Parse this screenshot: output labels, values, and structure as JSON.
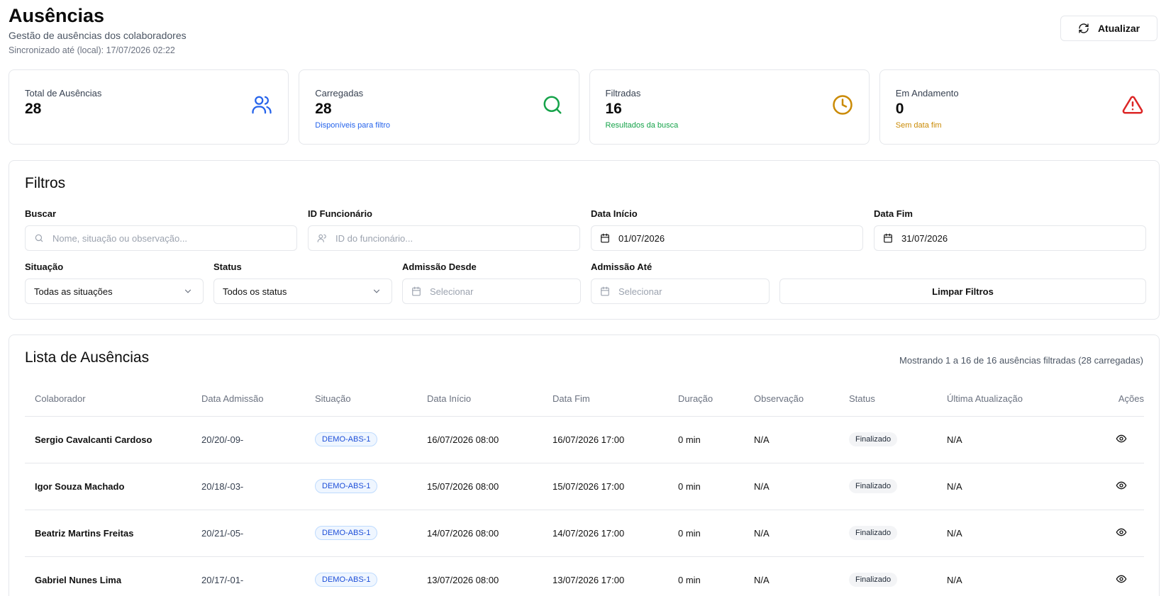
{
  "header": {
    "title": "Ausências",
    "subtitle": "Gestão de ausências dos colaboradores",
    "sync": "Sincronizado até (local): 17/07/2026 02:22",
    "refresh_label": "Atualizar"
  },
  "stats": [
    {
      "label": "Total de Ausências",
      "value": "28",
      "sub": "",
      "icon": "users-icon",
      "color": "#2563eb"
    },
    {
      "label": "Carregadas",
      "value": "28",
      "sub": "Disponíveis para filtro",
      "icon": "search-icon",
      "color": "#16a34a"
    },
    {
      "label": "Filtradas",
      "value": "16",
      "sub": "Resultados da busca",
      "icon": "clock-icon",
      "color": "#ca8a04"
    },
    {
      "label": "Em Andamento",
      "value": "0",
      "sub": "Sem data fim",
      "icon": "alert-triangle-icon",
      "color": "#dc2626"
    }
  ],
  "filters": {
    "title": "Filtros",
    "search": {
      "label": "Buscar",
      "placeholder": "Nome, situação ou observação..."
    },
    "employee": {
      "label": "ID Funcionário",
      "placeholder": "ID do funcionário..."
    },
    "start": {
      "label": "Data Início",
      "value": "01/07/2026"
    },
    "end": {
      "label": "Data Fim",
      "value": "31/07/2026"
    },
    "situation": {
      "label": "Situação",
      "value": "Todas as situações"
    },
    "status": {
      "label": "Status",
      "value": "Todos os status"
    },
    "adm_from": {
      "label": "Admissão Desde",
      "placeholder": "Selecionar"
    },
    "adm_to": {
      "label": "Admissão Até",
      "placeholder": "Selecionar"
    },
    "clear_label": "Limpar Filtros"
  },
  "list": {
    "title": "Lista de Ausências",
    "info": "Mostrando 1 a 16 de 16 ausências filtradas (28 carregadas)",
    "columns": [
      "Colaborador",
      "Data Admissão",
      "Situação",
      "Data Início",
      "Data Fim",
      "Duração",
      "Observação",
      "Status",
      "Última Atualização",
      "Ações"
    ],
    "rows": [
      {
        "name": "Sergio Cavalcanti Cardoso",
        "admission": "20/20/-09-",
        "situation": "DEMO-ABS-1",
        "start": "16/07/2026 08:00",
        "end": "16/07/2026 17:00",
        "duration": "0 min",
        "obs": "N/A",
        "status": "Finalizado",
        "updated": "N/A"
      },
      {
        "name": "Igor Souza Machado",
        "admission": "20/18/-03-",
        "situation": "DEMO-ABS-1",
        "start": "15/07/2026 08:00",
        "end": "15/07/2026 17:00",
        "duration": "0 min",
        "obs": "N/A",
        "status": "Finalizado",
        "updated": "N/A"
      },
      {
        "name": "Beatriz Martins Freitas",
        "admission": "20/21/-05-",
        "situation": "DEMO-ABS-1",
        "start": "14/07/2026 08:00",
        "end": "14/07/2026 17:00",
        "duration": "0 min",
        "obs": "N/A",
        "status": "Finalizado",
        "updated": "N/A"
      },
      {
        "name": "Gabriel Nunes Lima",
        "admission": "20/17/-01-",
        "situation": "DEMO-ABS-1",
        "start": "13/07/2026 08:00",
        "end": "13/07/2026 17:00",
        "duration": "0 min",
        "obs": "N/A",
        "status": "Finalizado",
        "updated": "N/A"
      }
    ]
  }
}
